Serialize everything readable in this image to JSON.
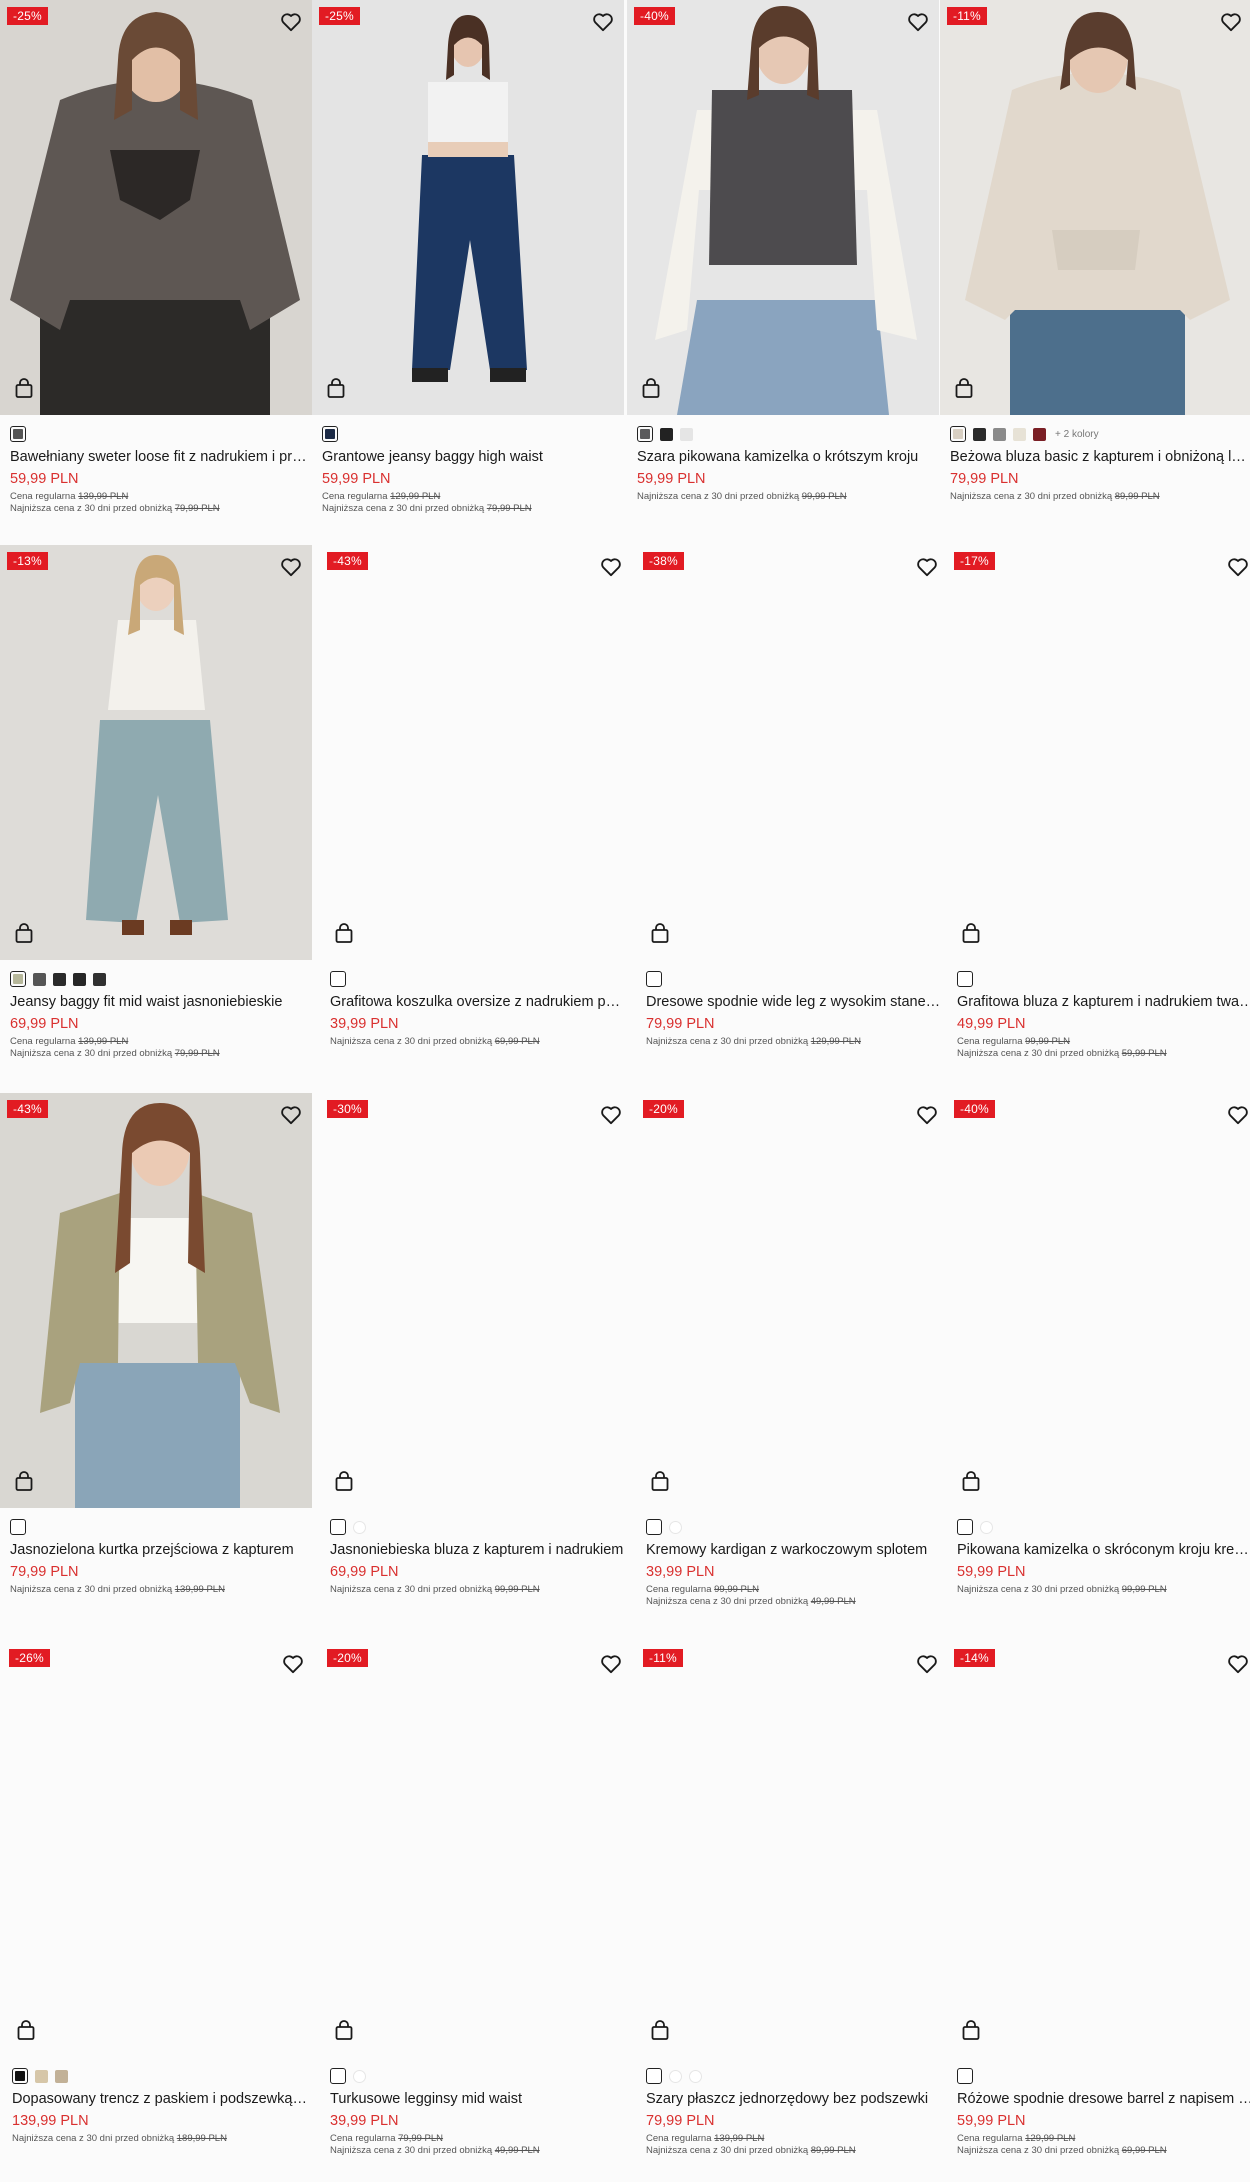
{
  "colors": {
    "badge": "#e21b23",
    "price": "#d9302f",
    "background": "#fbfbfb"
  },
  "labels": {
    "regular": "Cena regularna",
    "lowest": "Najniższa cena z 30 dni przed obniżką"
  },
  "products": [
    {
      "badge": "-25%",
      "name": "Bawełniany sweter loose fit z nadrukiem i przetarciami",
      "price": "59,99 PLN",
      "regular": "139,99 PLN",
      "lowest": "79,99 PLN",
      "swatches": [
        "#555555"
      ],
      "more": "",
      "photo": "sweater"
    },
    {
      "badge": "-25%",
      "name": "Grantowe jeansy baggy high waist",
      "price": "59,99 PLN",
      "regular": "129,99 PLN",
      "lowest": "79,99 PLN",
      "swatches": [
        "#1c2a45"
      ],
      "more": "",
      "photo": "jeans"
    },
    {
      "badge": "-40%",
      "name": "Szara pikowana kamizelka o krótszym kroju",
      "price": "59,99 PLN",
      "regular": "",
      "lowest": "99,99 PLN",
      "swatches": [
        "#5a5a5c",
        "#222222",
        "#e5e5e5"
      ],
      "more": "",
      "photo": "vest"
    },
    {
      "badge": "-11%",
      "name": "Beżowa bluza basic z kapturem i obniżoną linią ramion",
      "price": "79,99 PLN",
      "regular": "",
      "lowest": "89,99 PLN",
      "swatches": [
        "#d8cfc2",
        "#2a2a2a",
        "#8a8a8a",
        "#e7e2d6",
        "#7a1f25"
      ],
      "more": "+ 2 kolory",
      "photo": "hoodie"
    },
    {
      "badge": "-13%",
      "name": "Jeansy baggy fit mid waist jasnoniebieskie",
      "price": "69,99 PLN",
      "regular": "139,99 PLN",
      "lowest": "79,99 PLN",
      "swatches": [
        "#b6b79a",
        "#555555",
        "#2a2a2a",
        "#262626",
        "#303030"
      ],
      "more": "",
      "photo": "baggy"
    },
    {
      "badge": "-43%",
      "name": "Grafitowa koszulka oversize z nadrukiem pajęczyny",
      "price": "39,99 PLN",
      "regular": "",
      "lowest": "69,99 PLN",
      "swatches": [
        "empty"
      ],
      "more": "",
      "photo": ""
    },
    {
      "badge": "-38%",
      "name": "Dresowe spodnie wide leg z wysokim stanem szare",
      "price": "79,99 PLN",
      "regular": "",
      "lowest": "129,99 PLN",
      "swatches": [
        "empty"
      ],
      "more": "",
      "photo": ""
    },
    {
      "badge": "-17%",
      "name": "Grafitowa bluza z kapturem i nadrukiem twarzy",
      "price": "49,99 PLN",
      "regular": "99,99 PLN",
      "lowest": "59,99 PLN",
      "swatches": [
        "empty"
      ],
      "more": "",
      "photo": ""
    },
    {
      "badge": "-43%",
      "name": "Jasnozielona kurtka przejściowa z kapturem",
      "price": "79,99 PLN",
      "regular": "",
      "lowest": "139,99 PLN",
      "swatches": [
        "empty"
      ],
      "more": "",
      "photo": "jacket"
    },
    {
      "badge": "-30%",
      "name": "Jasnoniebieska bluza z kapturem i nadrukiem",
      "price": "69,99 PLN",
      "regular": "",
      "lowest": "99,99 PLN",
      "swatches": [
        "empty",
        "light"
      ],
      "more": "",
      "photo": ""
    },
    {
      "badge": "-20%",
      "name": "Kremowy kardigan z warkoczowym splotem",
      "price": "39,99 PLN",
      "regular": "99,99 PLN",
      "lowest": "49,99 PLN",
      "swatches": [
        "empty",
        "light"
      ],
      "more": "",
      "photo": ""
    },
    {
      "badge": "-40%",
      "name": "Pikowana kamizelka o skróconym kroju kremowa",
      "price": "59,99 PLN",
      "regular": "",
      "lowest": "99,99 PLN",
      "swatches": [
        "empty",
        "light"
      ],
      "more": "",
      "photo": ""
    },
    {
      "badge": "-26%",
      "name": "Dopasowany trencz z paskiem i podszewką beżowy",
      "price": "139,99 PLN",
      "regular": "",
      "lowest": "189,99 PLN",
      "swatches": [
        "#111111",
        "#d6c6a8",
        "#c2b197"
      ],
      "more": "",
      "photo": ""
    },
    {
      "badge": "-20%",
      "name": "Turkusowe legginsy mid waist",
      "price": "39,99 PLN",
      "regular": "79,99 PLN",
      "lowest": "49,99 PLN",
      "swatches": [
        "empty",
        "light"
      ],
      "more": "",
      "photo": ""
    },
    {
      "badge": "-11%",
      "name": "Szary płaszcz jednorzędowy bez podszewki",
      "price": "79,99 PLN",
      "regular": "139,99 PLN",
      "lowest": "89,99 PLN",
      "swatches": [
        "empty",
        "light",
        "light"
      ],
      "more": "",
      "photo": ""
    },
    {
      "badge": "-14%",
      "name": "Różowe spodnie dresowe barrel z napisem na pasie",
      "price": "59,99 PLN",
      "regular": "129,99 PLN",
      "lowest": "69,99 PLN",
      "swatches": [
        "empty"
      ],
      "more": "",
      "photo": ""
    }
  ]
}
